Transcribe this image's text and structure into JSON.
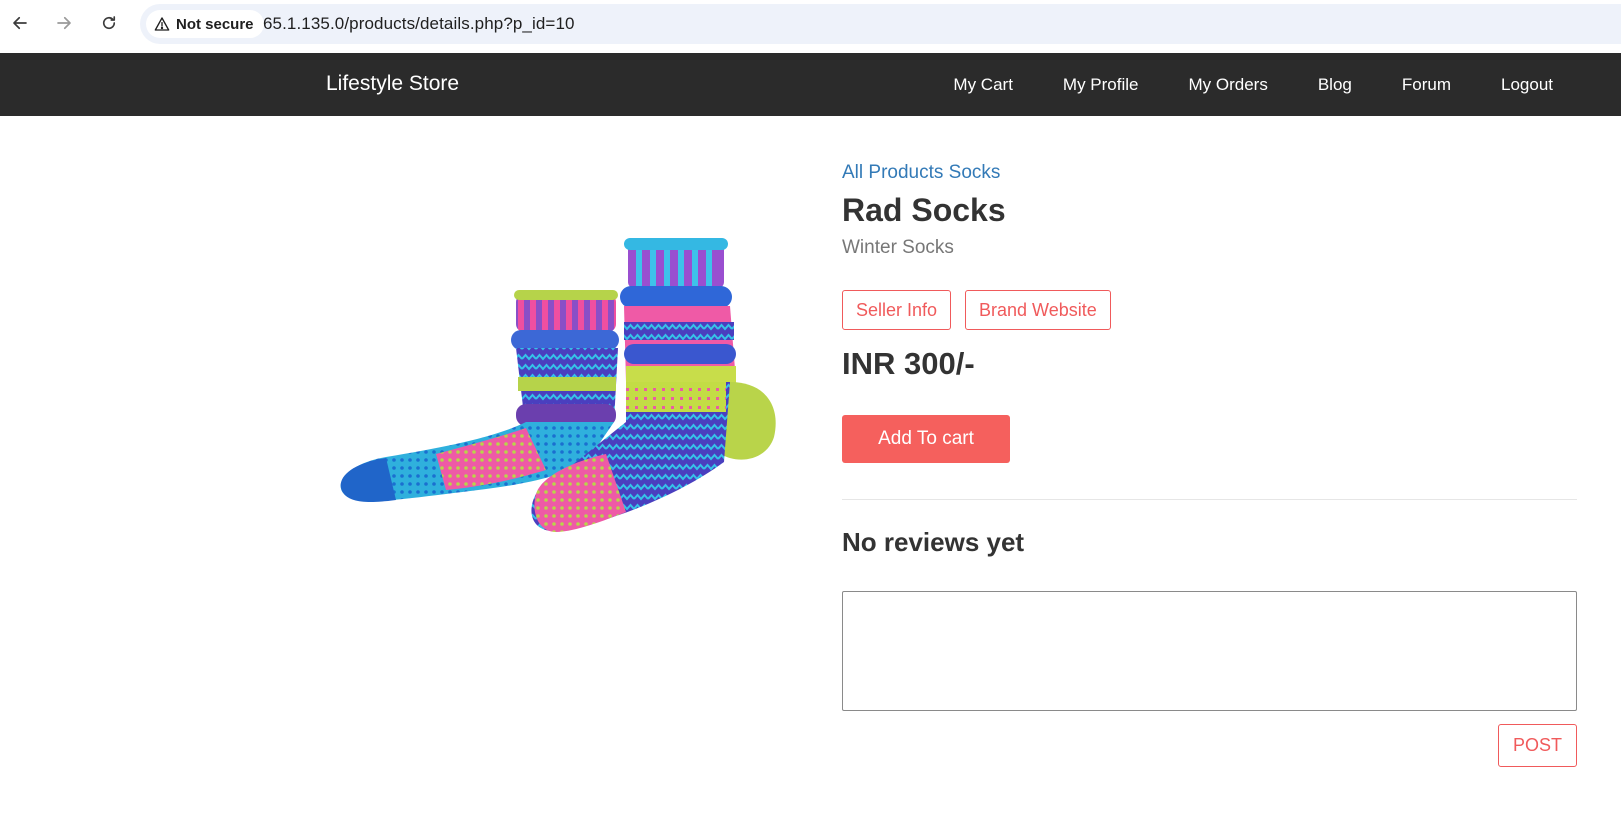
{
  "browser": {
    "back_icon": "arrow-left-icon",
    "forward_icon": "arrow-right-icon",
    "reload_icon": "reload-icon",
    "security_icon": "warning-triangle-icon",
    "security_label": "Not secure",
    "url": "65.1.135.0/products/details.php?p_id=10"
  },
  "navbar": {
    "brand": "Lifestyle Store",
    "links": [
      "My Cart",
      "My Profile",
      "My Orders",
      "Blog",
      "Forum",
      "Logout"
    ]
  },
  "product": {
    "breadcrumb": "All Products Socks",
    "title": "Rad Socks",
    "subtitle": "Winter Socks",
    "seller_info_label": "Seller Info",
    "brand_website_label": "Brand Website",
    "price": "INR 300/-",
    "add_to_cart_label": "Add To cart",
    "image_alt": "socks-image"
  },
  "reviews": {
    "heading": "No reviews yet",
    "input_value": "",
    "post_label": "POST"
  },
  "colors": {
    "navbar_bg": "#2b2b2b",
    "accent": "#f5605d",
    "link": "#337ab7"
  }
}
